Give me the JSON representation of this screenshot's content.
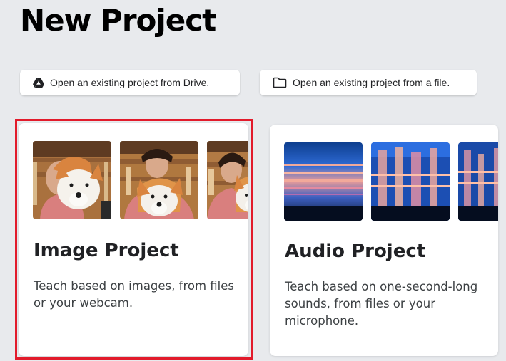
{
  "page": {
    "title": "New Project"
  },
  "open_buttons": {
    "drive": {
      "label": "Open an existing project from Drive.",
      "icon": "google-drive-icon"
    },
    "file": {
      "label": "Open an existing project from a file.",
      "icon": "folder-icon"
    }
  },
  "projects": [
    {
      "title": "Image Project",
      "description": "Teach based on images, from files or your webcam.",
      "thumbnails": [
        "person-with-plush-dog-photo",
        "person-with-plush-dog-photo",
        "person-with-plush-dog-photo"
      ],
      "selected": true
    },
    {
      "title": "Audio Project",
      "description": "Teach based on one-second-long sounds, from files or your microphone.",
      "thumbnails": [
        "spectrogram",
        "spectrogram",
        "spectrogram"
      ],
      "selected": false
    }
  ],
  "colors": {
    "background": "#e8eaed",
    "card": "#ffffff",
    "selection_outline": "#e21b2b"
  }
}
